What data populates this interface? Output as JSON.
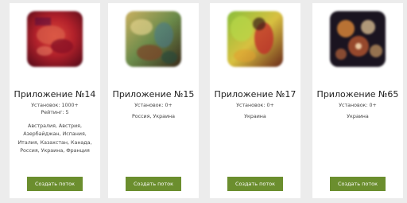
{
  "colors": {
    "page_background": "#ececec",
    "card_background": "#ffffff",
    "button_background": "#6b8e2e",
    "button_text": "#ffffff"
  },
  "cards": [
    {
      "title": "Приложение №14",
      "installs": "Установок: 1000+",
      "rating": "Рейтинг: 5",
      "countries": "Австралия, Австрия, Азербайджан, Испания, Италия, Казахстан, Канада, Россия, Украина, Франция",
      "button_label": "Создать поток"
    },
    {
      "title": "Приложение №15",
      "installs": "Установок: 0+",
      "countries": "Россия, Украина",
      "button_label": "Создать поток"
    },
    {
      "title": "Приложение №17",
      "installs": "Установок: 0+",
      "countries": "Украина",
      "button_label": "Создать поток"
    },
    {
      "title": "Приложение №65",
      "installs": "Установок: 0+",
      "countries": "Украина",
      "button_label": "Создать поток"
    }
  ]
}
